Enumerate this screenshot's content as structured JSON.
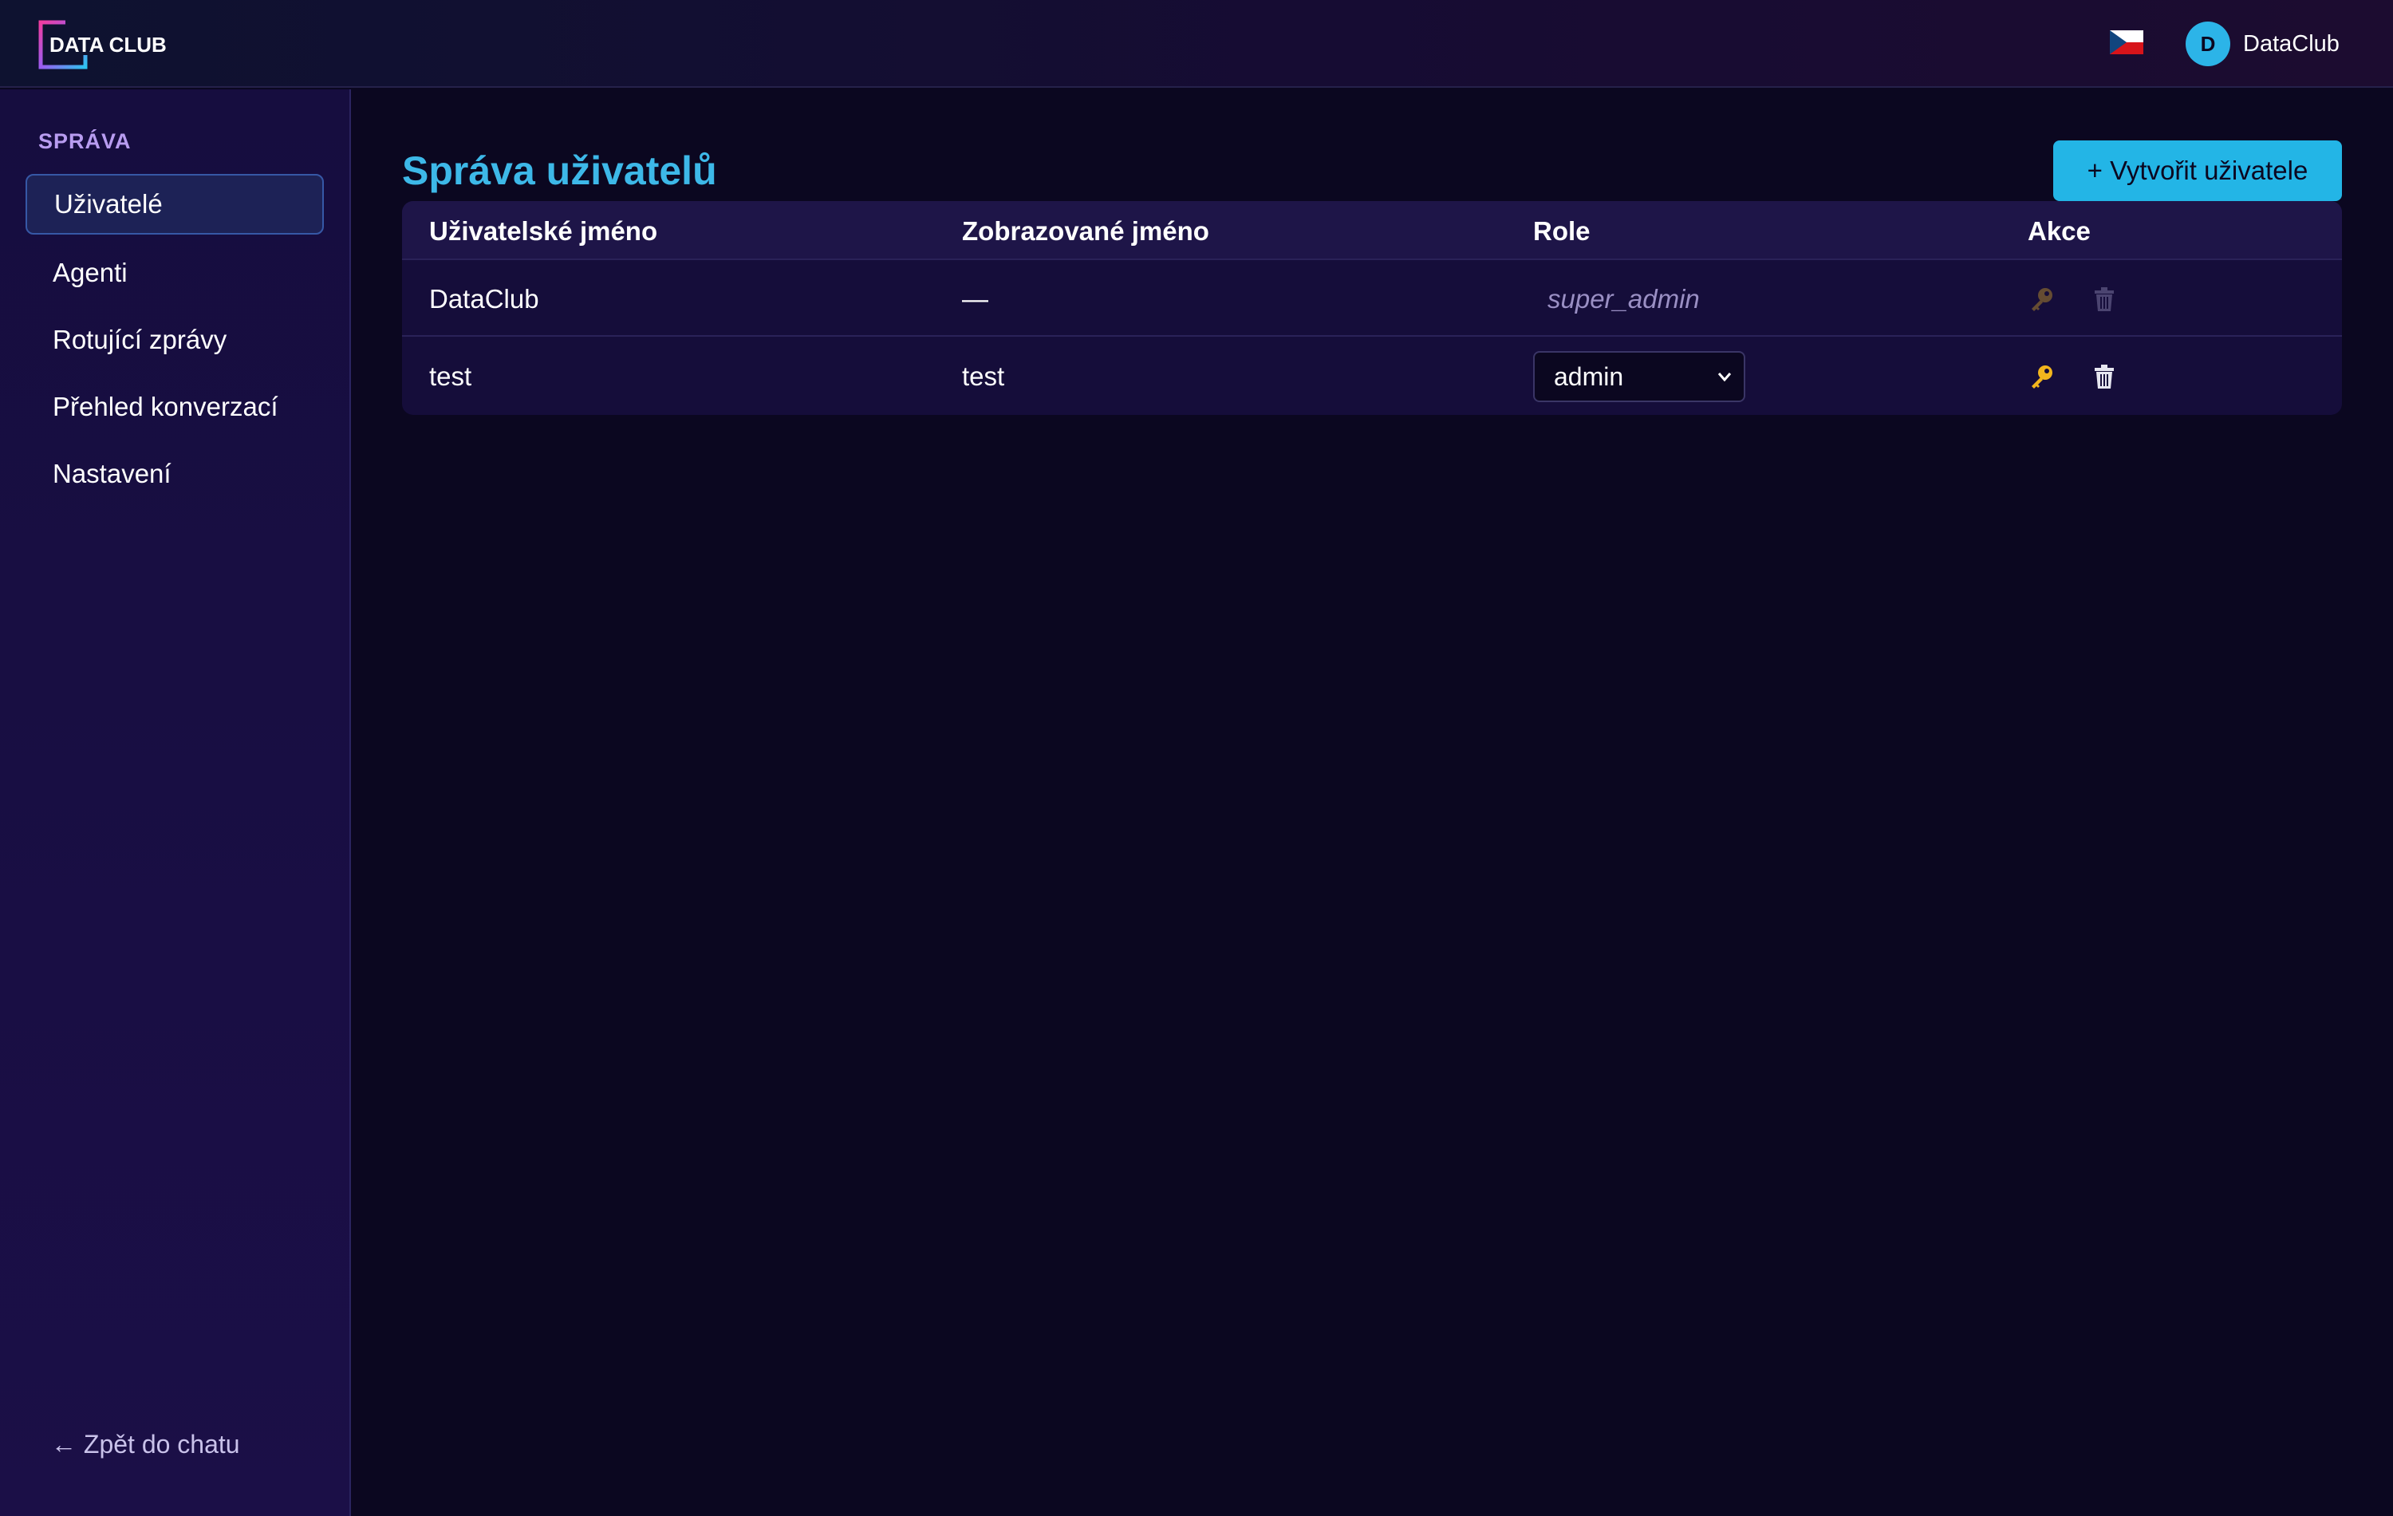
{
  "header": {
    "logo_text": "DATA CLUB",
    "language_flag": "czech-flag-icon",
    "avatar_initial": "D",
    "user_name": "DataClub"
  },
  "sidebar": {
    "section_heading": "SPRÁVA",
    "items": [
      {
        "label": "Uživatelé",
        "active": true
      },
      {
        "label": "Agenti",
        "active": false
      },
      {
        "label": "Rotující zprávy",
        "active": false
      },
      {
        "label": "Přehled konverzací",
        "active": false
      },
      {
        "label": "Nastavení",
        "active": false
      }
    ],
    "back_link": "← Zpět do chatu"
  },
  "main": {
    "title": "Správa uživatelů",
    "create_button": "+ Vytvořit uživatele",
    "table": {
      "columns": [
        "Uživatelské jméno",
        "Zobrazované jméno",
        "Role",
        "Akce"
      ],
      "rows": [
        {
          "username": "DataClub",
          "display_name": "—",
          "role": "super_admin",
          "role_editable": false,
          "actions_enabled": false
        },
        {
          "username": "test",
          "display_name": "test",
          "role": "admin",
          "role_editable": true,
          "actions_enabled": true
        }
      ]
    }
  },
  "colors": {
    "accent": "#23b5e6",
    "title": "#3db8e8",
    "background": "#0b0720",
    "sidebar": "#160d3f",
    "key_icon": "#f2b51d"
  }
}
